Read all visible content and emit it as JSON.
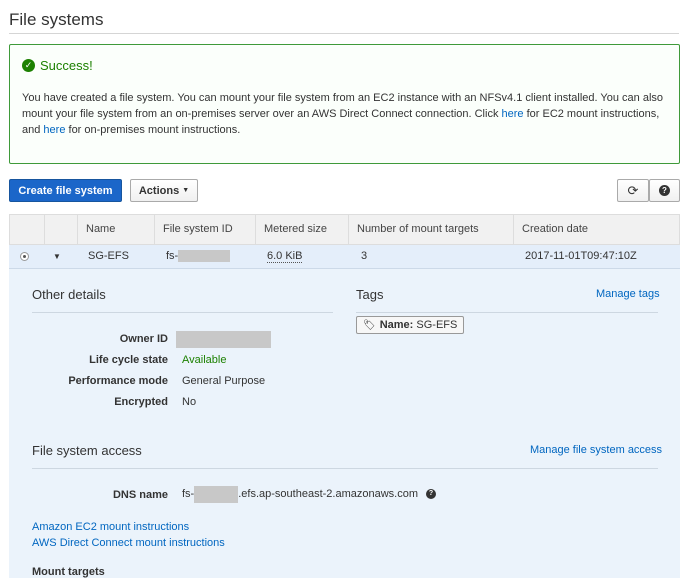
{
  "page": {
    "title": "File systems"
  },
  "success": {
    "title": "Success!",
    "msg_part1": "You have created a file system. You can mount your file system from an EC2 instance with an NFSv4.1 client installed. You can also mount your file system from an on-premises server over an AWS Direct Connect connection. Click ",
    "link1": "here",
    "msg_part2": " for EC2 mount instructions, and ",
    "link2": "here",
    "msg_part3": " for on-premises mount instructions."
  },
  "toolbar": {
    "create_label": "Create file system",
    "actions_label": "Actions",
    "refresh_icon": "refresh-icon",
    "help_icon": "help-icon"
  },
  "table": {
    "columns": [
      "Name",
      "File system ID",
      "Metered size",
      "Number of mount targets",
      "Creation date"
    ],
    "rows": [
      {
        "name": "SG-EFS",
        "fs_id_prefix": "fs-",
        "metered_size": "6.0 KiB",
        "mount_targets": "3",
        "creation_date": "2017-11-01T09:47:10Z"
      }
    ]
  },
  "details": {
    "other_details_title": "Other details",
    "tags_title": "Tags",
    "manage_tags": "Manage tags",
    "fields": [
      {
        "label": "Owner ID",
        "value": ""
      },
      {
        "label": "Life cycle state",
        "value": "Available"
      },
      {
        "label": "Performance mode",
        "value": "General Purpose"
      },
      {
        "label": "Encrypted",
        "value": "No"
      }
    ],
    "tag": {
      "key": "Name:",
      "value": "SG-EFS"
    },
    "access_title": "File system access",
    "manage_access": "Manage file system access",
    "dns_label": "DNS name",
    "dns_prefix": "fs-",
    "dns_suffix": ".efs.ap-southeast-2.amazonaws.com",
    "ec2_link": "Amazon EC2 mount instructions",
    "dc_link": "AWS Direct Connect mount instructions",
    "mount_targets_title": "Mount targets"
  },
  "colors": {
    "accent": "#1b66c9",
    "success": "#1d8102",
    "link": "#0066c0",
    "selected_row": "#e4eefa"
  }
}
